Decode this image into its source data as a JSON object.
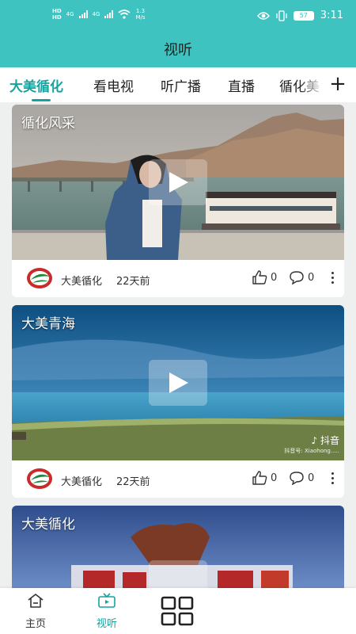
{
  "status_bar": {
    "left_labels": [
      "HD",
      "HD"
    ],
    "network_a": "4G",
    "network_b": "4G",
    "speed": "1.3\nM/s",
    "battery": "57",
    "time": "3:11"
  },
  "header": {
    "title": "视听"
  },
  "tabs": {
    "items": [
      {
        "label": "大美循化",
        "active": true
      },
      {
        "label": "看电视",
        "active": false
      },
      {
        "label": "听广播",
        "active": false
      },
      {
        "label": "直播",
        "active": false
      },
      {
        "label": "循化美",
        "active": false
      }
    ],
    "add_icon": "plus-icon"
  },
  "cards": [
    {
      "title": "循化风采",
      "source": "大美循化",
      "time_ago": "22天前",
      "likes": "0",
      "comments": "0"
    },
    {
      "title": "大美青海",
      "source": "大美循化",
      "time_ago": "22天前",
      "likes": "0",
      "comments": "0",
      "watermark": "抖音",
      "watermark_id": "抖音号: Xiaohong....."
    },
    {
      "title": "大美循化"
    }
  ],
  "bottom_nav": {
    "items": [
      {
        "label": "主页",
        "icon": "home-icon",
        "active": false
      },
      {
        "label": "视听",
        "icon": "tv-icon",
        "active": true
      },
      {
        "label": "",
        "icon": "grid-icon",
        "active": false
      }
    ]
  },
  "colors": {
    "accent": "#16a3a0",
    "header": "#3fc3c0"
  }
}
